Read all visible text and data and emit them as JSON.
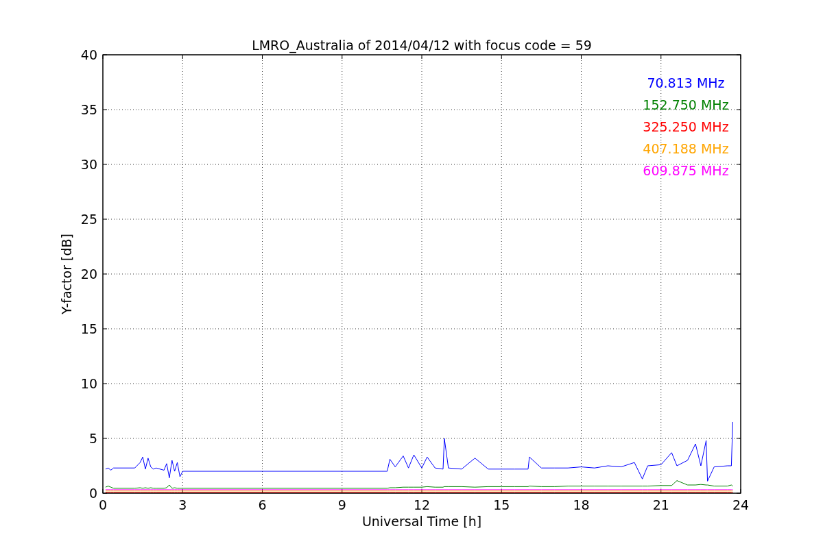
{
  "figure": {
    "chart_data": {
      "type": "line",
      "grid": true,
      "title": "LMRO_Australia of 2014/04/12 with focus code = 59",
      "xlabel": "Universal Time [h]",
      "ylabel": "Y-factor [dB]",
      "x": [
        0.1,
        0.2,
        0.3,
        0.4,
        1.2,
        1.4,
        1.5,
        1.6,
        1.7,
        1.8,
        1.9,
        2.0,
        2.3,
        2.4,
        2.5,
        2.6,
        2.7,
        2.8,
        2.9,
        3.0,
        10.7,
        10.8,
        11.0,
        11.3,
        11.5,
        11.7,
        12.0,
        12.2,
        12.5,
        12.8,
        12.85,
        13.0,
        13.5,
        14.0,
        14.5,
        15.0,
        15.5,
        16.0,
        16.05,
        16.5,
        17.0,
        17.5,
        18.0,
        18.5,
        19.0,
        19.5,
        20.0,
        20.3,
        20.5,
        21.0,
        21.4,
        21.6,
        22.0,
        22.3,
        22.5,
        22.7,
        22.75,
        23.0,
        23.5,
        23.65,
        23.7
      ],
      "series": [
        {
          "name": "70.813 MHz",
          "color": "#0000ff",
          "values": [
            2.2,
            2.3,
            2.1,
            2.3,
            2.3,
            2.8,
            3.3,
            2.2,
            3.2,
            2.4,
            2.2,
            2.3,
            2.1,
            2.7,
            1.4,
            3.0,
            2.0,
            2.8,
            1.5,
            2.0,
            2.0,
            3.1,
            2.4,
            3.4,
            2.3,
            3.5,
            2.3,
            3.3,
            2.3,
            2.2,
            5.0,
            2.3,
            2.2,
            3.2,
            2.2,
            2.2,
            2.2,
            2.2,
            3.3,
            2.3,
            2.3,
            2.3,
            2.4,
            2.3,
            2.5,
            2.4,
            2.8,
            1.3,
            2.5,
            2.6,
            3.7,
            2.5,
            3.0,
            4.5,
            2.5,
            4.8,
            1.1,
            2.4,
            2.5,
            2.5,
            6.5
          ]
        },
        {
          "name": "152.750 MHz",
          "color": "#008000",
          "values": [
            0.55,
            0.65,
            0.55,
            0.45,
            0.45,
            0.5,
            0.45,
            0.5,
            0.45,
            0.5,
            0.45,
            0.45,
            0.45,
            0.5,
            0.75,
            0.45,
            0.5,
            0.45,
            0.45,
            0.45,
            0.45,
            0.5,
            0.5,
            0.55,
            0.55,
            0.55,
            0.55,
            0.6,
            0.55,
            0.55,
            0.6,
            0.6,
            0.6,
            0.55,
            0.6,
            0.6,
            0.6,
            0.6,
            0.65,
            0.6,
            0.6,
            0.65,
            0.65,
            0.65,
            0.65,
            0.65,
            0.65,
            0.65,
            0.65,
            0.7,
            0.7,
            1.15,
            0.75,
            0.75,
            0.8,
            0.75,
            0.75,
            0.65,
            0.65,
            0.75,
            0.65
          ]
        },
        {
          "name": "325.250 MHz",
          "color": "#ff0000",
          "values": [
            0.08,
            0.08,
            0.08,
            0.08,
            0.08,
            0.08,
            0.08,
            0.08,
            0.08,
            0.08,
            0.08,
            0.08,
            0.08,
            0.08,
            0.08,
            0.08,
            0.08,
            0.08,
            0.08,
            0.08,
            0.08,
            0.08,
            0.08,
            0.08,
            0.08,
            0.08,
            0.08,
            0.08,
            0.08,
            0.08,
            0.08,
            0.08,
            0.08,
            0.08,
            0.08,
            0.08,
            0.08,
            0.08,
            0.08,
            0.08,
            0.08,
            0.08,
            0.08,
            0.08,
            0.08,
            0.08,
            0.08,
            0.08,
            0.08,
            0.08,
            0.08,
            0.08,
            0.08,
            0.08,
            0.08,
            0.08,
            0.08,
            0.08,
            0.08,
            0.08,
            0.08
          ]
        },
        {
          "name": "407.188 MHz",
          "color": "#ffa500",
          "values": [
            0.2,
            0.2,
            0.2,
            0.2,
            0.2,
            0.2,
            0.2,
            0.2,
            0.2,
            0.2,
            0.2,
            0.2,
            0.2,
            0.2,
            0.2,
            0.2,
            0.2,
            0.2,
            0.2,
            0.2,
            0.2,
            0.2,
            0.2,
            0.2,
            0.2,
            0.2,
            0.2,
            0.2,
            0.2,
            0.2,
            0.2,
            0.2,
            0.2,
            0.2,
            0.2,
            0.2,
            0.2,
            0.2,
            0.2,
            0.2,
            0.2,
            0.2,
            0.2,
            0.2,
            0.2,
            0.2,
            0.2,
            0.2,
            0.2,
            0.2,
            0.2,
            0.2,
            0.2,
            0.2,
            0.2,
            0.2,
            0.2,
            0.2,
            0.2,
            0.2,
            0.2
          ]
        },
        {
          "name": "609.875 MHz",
          "color": "#ff00ff",
          "values": [
            0.32,
            0.32,
            0.32,
            0.32,
            0.32,
            0.32,
            0.32,
            0.32,
            0.32,
            0.32,
            0.32,
            0.32,
            0.32,
            0.32,
            0.32,
            0.32,
            0.32,
            0.32,
            0.32,
            0.32,
            0.32,
            0.32,
            0.32,
            0.32,
            0.32,
            0.32,
            0.32,
            0.32,
            0.32,
            0.32,
            0.32,
            0.32,
            0.32,
            0.32,
            0.32,
            0.32,
            0.32,
            0.32,
            0.32,
            0.32,
            0.32,
            0.32,
            0.32,
            0.32,
            0.32,
            0.32,
            0.32,
            0.32,
            0.32,
            0.32,
            0.32,
            0.32,
            0.32,
            0.32,
            0.32,
            0.32,
            0.32,
            0.32,
            0.32,
            0.32,
            0.32
          ]
        }
      ],
      "xlim": [
        0,
        24
      ],
      "ylim": [
        0,
        40
      ],
      "xticks": [
        0,
        3,
        6,
        9,
        12,
        15,
        18,
        21,
        24
      ],
      "yticks": [
        0,
        5,
        10,
        15,
        20,
        25,
        30,
        35,
        40
      ]
    }
  }
}
